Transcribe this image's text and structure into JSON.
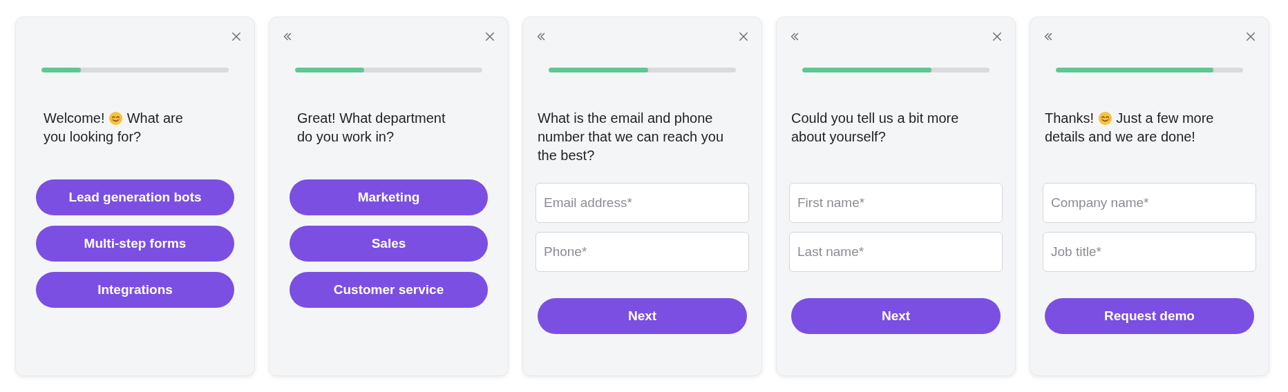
{
  "cards": [
    {
      "back": false,
      "progress": {
        "level": 0.21
      },
      "question": [
        {
          "kind": "text",
          "text": "Welcome!"
        },
        {
          "kind": "emoji"
        },
        {
          "kind": "text",
          "text": "What are"
        },
        {
          "kind": "text",
          "text": "you looking for?"
        }
      ],
      "kind": "choices",
      "options": [
        "Lead generation bots",
        "Multi-step forms",
        "Integrations"
      ]
    },
    {
      "back": true,
      "progress": {
        "level": 0.37
      },
      "question": [
        {
          "kind": "text",
          "text": "Great! What department do you work in?"
        }
      ],
      "kind": "choices",
      "options": [
        "Marketing",
        "Sales",
        "Customer service"
      ]
    },
    {
      "back": true,
      "progress": {
        "level": 0.53
      },
      "question": [
        {
          "kind": "text",
          "text": "What is the email and phone number that we can reach you the best?"
        }
      ],
      "kind": "form",
      "fields": [
        {
          "placeholder": "Email address*"
        },
        {
          "placeholder": "Phone*"
        }
      ],
      "submit": "Next"
    },
    {
      "back": true,
      "progress": {
        "level": 0.69
      },
      "question": [
        {
          "kind": "text",
          "text": "Could you tell us a bit more about yourself?"
        }
      ],
      "kind": "form",
      "fields": [
        {
          "placeholder": "First name*"
        },
        {
          "placeholder": "Last name*"
        }
      ],
      "submit": "Next"
    },
    {
      "back": true,
      "progress": {
        "level": 0.84
      },
      "question": [
        {
          "kind": "text",
          "text": "Thanks!"
        },
        {
          "kind": "emoji"
        },
        {
          "kind": "text",
          "text": "Just a few more"
        },
        {
          "kind": "text",
          "text": "details and we are done!"
        }
      ],
      "kind": "form",
      "fields": [
        {
          "placeholder": "Company name*"
        },
        {
          "placeholder": "Job title*"
        }
      ],
      "submit": "Request demo"
    }
  ]
}
